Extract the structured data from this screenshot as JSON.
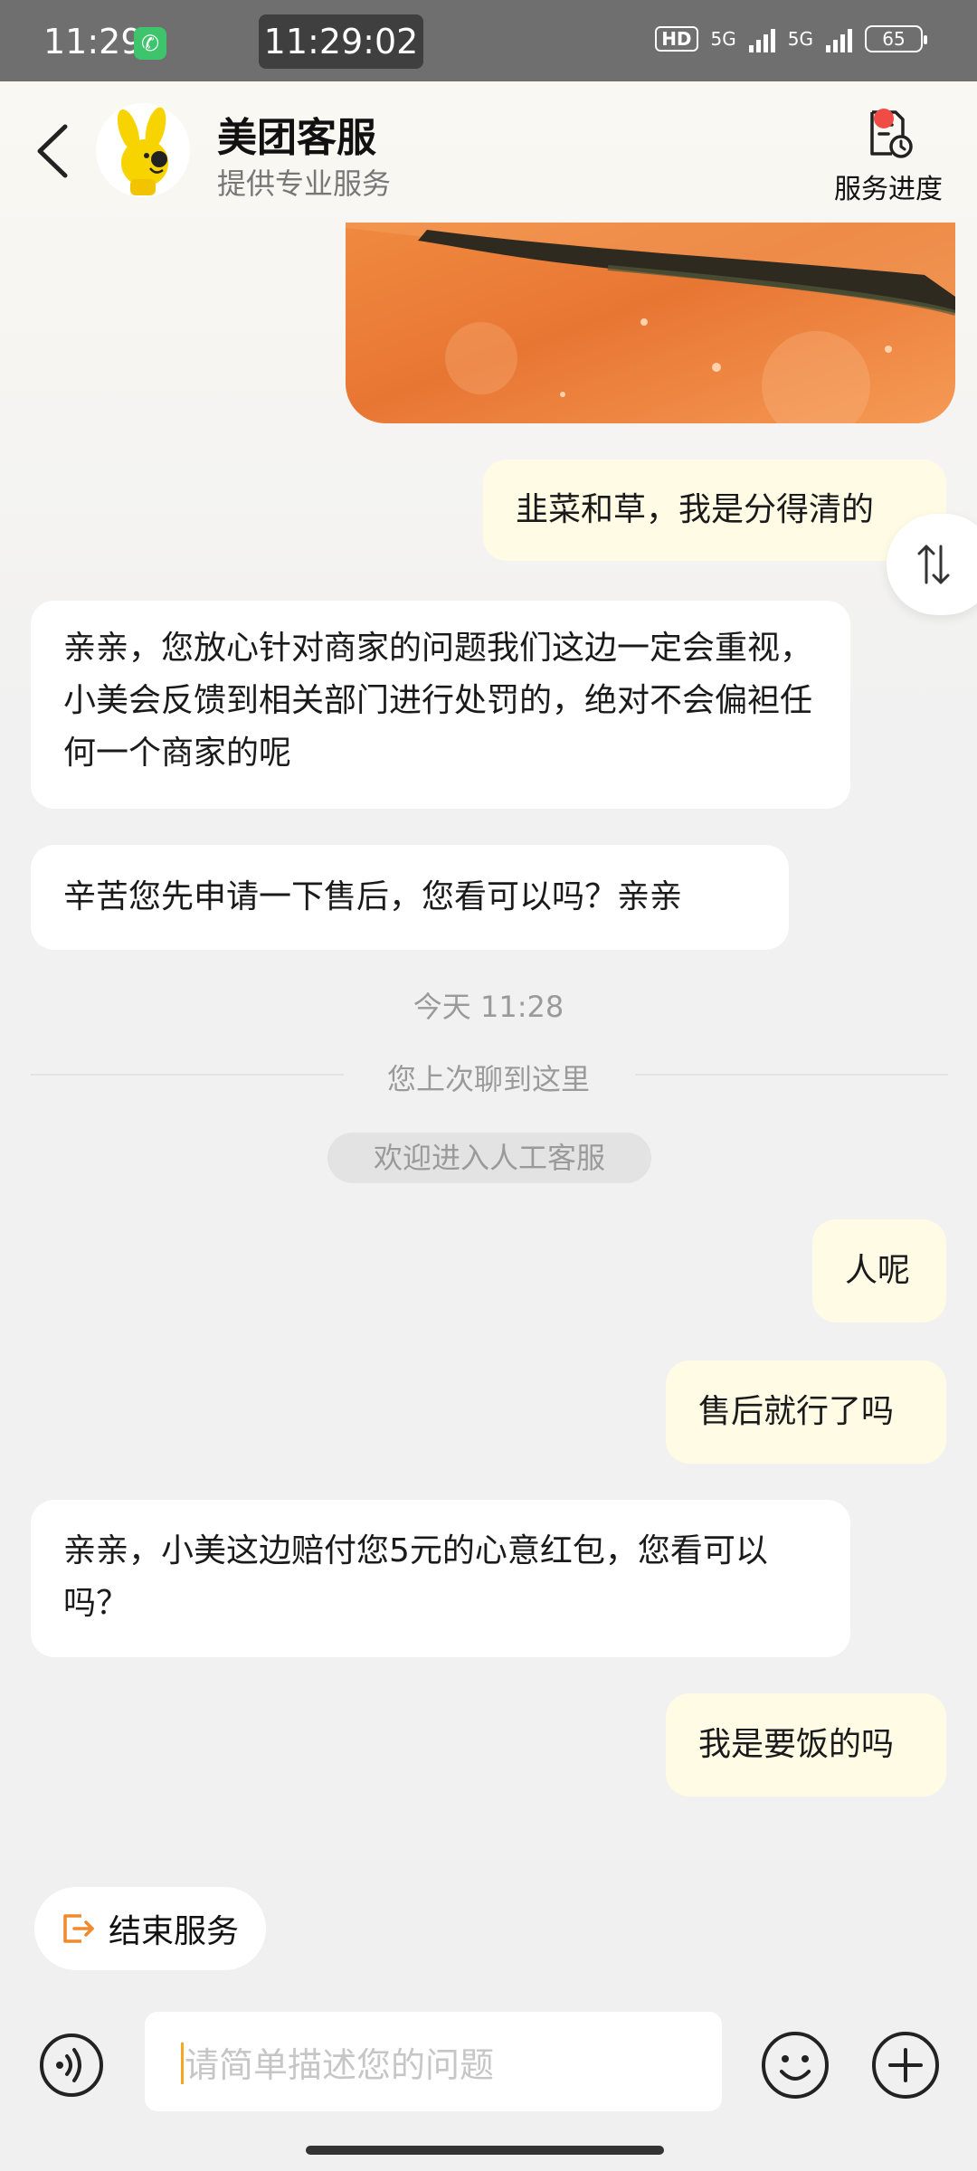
{
  "status_bar": {
    "time": "11:29",
    "call_timer": "11:29:02",
    "hd_label": "HD",
    "network_1": "5G",
    "network_2": "5G",
    "battery": "65"
  },
  "header": {
    "title": "美团客服",
    "subtitle": "提供专业服务",
    "progress_label": "服务进度"
  },
  "messages": {
    "m1": "韭菜和草，我是分得清的",
    "m2": "亲亲，您放心针对商家的问题我们这边一定会重视，小美会反馈到相关部门进行处罚的，绝对不会偏袒任何一个商家的呢",
    "m3": "辛苦您先申请一下售后，您看可以吗？亲亲",
    "m5": "人呢",
    "m6": "售后就行了吗",
    "m7": "亲亲，小美这边赔付您5元的心意红包，您看可以吗？",
    "m8": "我是要饭的吗"
  },
  "system": {
    "timestamp": "今天 11:28",
    "last_read": "您上次聊到这里",
    "welcome": "欢迎进入人工客服"
  },
  "bottom": {
    "end_service_label": "结束服务",
    "input_placeholder": "请简单描述您的问题"
  },
  "colors": {
    "my_bubble": "#fffbe5",
    "their_bubble": "#ffffff",
    "accent_orange": "#f5a623",
    "badge_red": "#f04b45"
  }
}
